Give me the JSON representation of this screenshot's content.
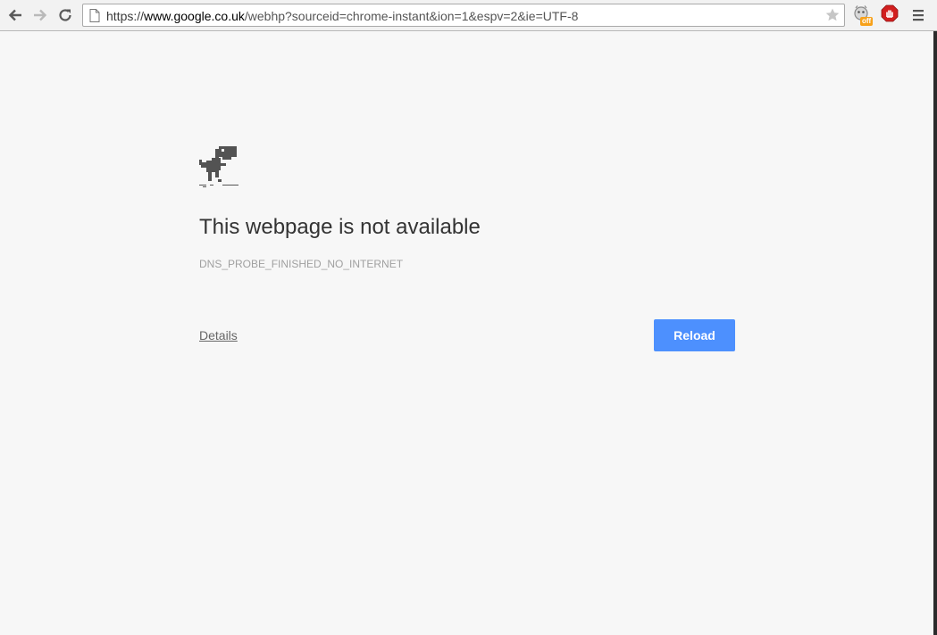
{
  "toolbar": {
    "url_scheme": "https://",
    "url_host": "www.google.co.uk",
    "url_path": "/webhp?sourceid=chrome-instant&ion=1&espv=2&ie=UTF-8",
    "extension_badge": "off"
  },
  "error_page": {
    "title": "This webpage is not available",
    "error_code": "DNS_PROBE_FINISHED_NO_INTERNET",
    "details_label": "Details",
    "reload_label": "Reload"
  },
  "colors": {
    "page_background": "#f7f7f7",
    "reload_button": "#4d90fe",
    "title_text": "#333333",
    "error_code_text": "#a0a0a0"
  },
  "icons": [
    "back-arrow-icon",
    "forward-arrow-icon",
    "reload-icon",
    "page-icon",
    "star-icon",
    "extension-icon",
    "adblock-icon",
    "menu-icon",
    "dinosaur-icon"
  ]
}
